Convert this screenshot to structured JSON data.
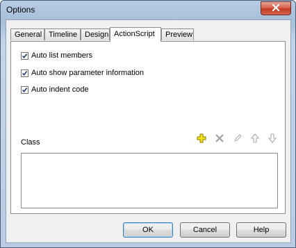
{
  "window": {
    "title": "Options"
  },
  "tabs": [
    {
      "label": "General"
    },
    {
      "label": "Timeline"
    },
    {
      "label": "Design"
    },
    {
      "label": "ActionScript"
    },
    {
      "label": "Preview"
    }
  ],
  "active_tab": "ActionScript",
  "options": [
    {
      "label": "Auto list members",
      "checked": true
    },
    {
      "label": "Auto show parameter information",
      "checked": true
    },
    {
      "label": "Auto indent code",
      "checked": true
    }
  ],
  "class_section": {
    "label": "Class",
    "toolbar": [
      "add-icon",
      "delete-icon",
      "edit-icon",
      "move-up-icon",
      "move-down-icon"
    ],
    "items": []
  },
  "buttons": {
    "ok": "OK",
    "cancel": "Cancel",
    "help": "Help"
  },
  "colors": {
    "add_icon": "#e8d200",
    "accent": "#3c7fb1",
    "close_button": "#c23a22"
  }
}
